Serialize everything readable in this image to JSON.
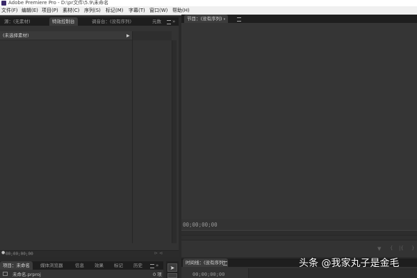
{
  "window": {
    "title": "Adobe Premiere Pro - D:\\pr文件\\5.9\\未命名"
  },
  "menu": [
    {
      "label": "文件(F)"
    },
    {
      "label": "编辑(E)"
    },
    {
      "label": "项目(P)"
    },
    {
      "label": "素材(C)"
    },
    {
      "label": "序列(S)"
    },
    {
      "label": "标记(M)"
    },
    {
      "label": "字幕(T)"
    },
    {
      "label": "窗口(W)"
    },
    {
      "label": "帮助(H)"
    }
  ],
  "source_panel": {
    "tabs": [
      {
        "label": "源：(无素材)"
      },
      {
        "label": "特效控制台"
      },
      {
        "label": "调音台：(没有序列)"
      },
      {
        "label": "元数"
      }
    ],
    "active_tab": 1,
    "no_clip_label": "(未选择素材)",
    "timecode": "00;00;00;00"
  },
  "program_monitor": {
    "tab_label": "节目：(没有序列)",
    "timecode": "00;00;00;00"
  },
  "project_panel": {
    "tabs": [
      {
        "label": "项目：未命名"
      },
      {
        "label": "媒体浏览器"
      },
      {
        "label": "信息"
      },
      {
        "label": "效果"
      },
      {
        "label": "标记"
      },
      {
        "label": "历史"
      }
    ],
    "file_name": "未命名.prproj",
    "item_count": "0 项"
  },
  "timeline_panel": {
    "tab_label": "时间线：(没有序列)",
    "timecode": "00;00;00;00"
  },
  "watermark": "头条 @我家丸子是金毛",
  "colors": {
    "panel_bg": "#333333",
    "tab_bg": "#1e1e1e",
    "titlebar": "#ffffff",
    "accent_icon": "#3a2a6a"
  }
}
